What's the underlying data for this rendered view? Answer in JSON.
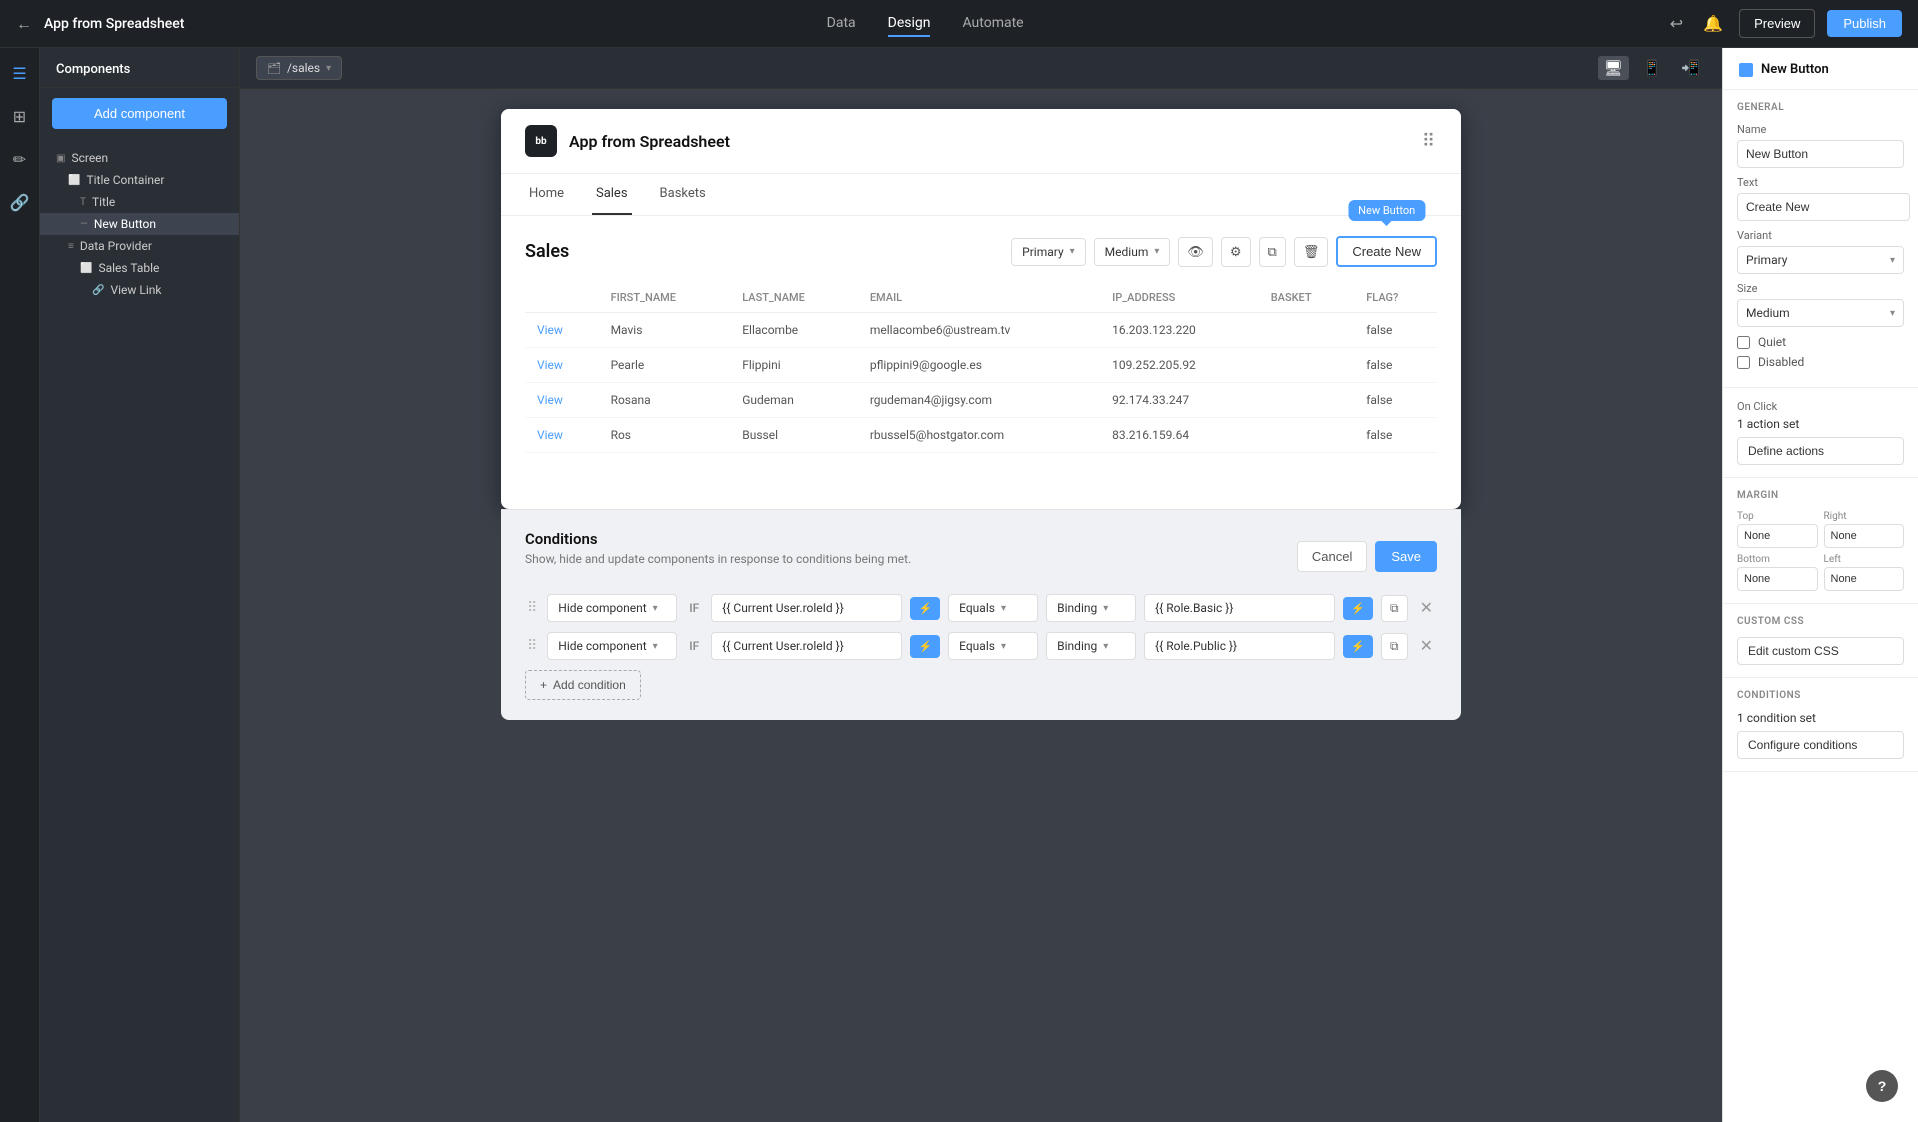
{
  "topbar": {
    "app_title": "App from Spreadsheet",
    "tabs": [
      "Data",
      "Design",
      "Automate"
    ],
    "active_tab": "Design",
    "preview_label": "Preview",
    "publish_label": "Publish"
  },
  "components_panel": {
    "header": "Components",
    "add_btn": "Add component",
    "tree": [
      {
        "id": "screen",
        "label": "Screen",
        "indent": 0,
        "icon": "▣",
        "active": false
      },
      {
        "id": "title-container",
        "label": "Title Container",
        "indent": 1,
        "icon": "⬜",
        "active": false
      },
      {
        "id": "title",
        "label": "Title",
        "indent": 2,
        "icon": "T",
        "active": false
      },
      {
        "id": "new-button",
        "label": "New Button",
        "indent": 2,
        "icon": "—",
        "active": true
      },
      {
        "id": "data-provider",
        "label": "Data Provider",
        "indent": 1,
        "icon": "≡",
        "active": false
      },
      {
        "id": "sales-table",
        "label": "Sales Table",
        "indent": 2,
        "icon": "⬜",
        "active": false
      },
      {
        "id": "view-link",
        "label": "View Link",
        "indent": 3,
        "icon": "🔗",
        "active": false
      }
    ]
  },
  "canvas": {
    "path": "/sales",
    "app_logo": "bb",
    "app_name": "App from Spreadsheet",
    "nav_items": [
      "Home",
      "Sales",
      "Baskets"
    ],
    "active_nav": "Sales",
    "section_title": "Sales",
    "toolbar": {
      "variant": "Primary",
      "size": "Medium"
    },
    "tooltip_label": "New Button",
    "create_new_label": "Create New",
    "table": {
      "columns": [
        "",
        "FIRST_NAME",
        "LAST_NAME",
        "EMAIL",
        "IP_ADDRESS",
        "BASKET",
        "FLAG?"
      ],
      "rows": [
        [
          "View",
          "Mavis",
          "Ellacombe",
          "mellacombe6@ustream.tv",
          "16.203.123.220",
          "",
          "false"
        ],
        [
          "View",
          "Pearle",
          "Flippini",
          "pflippini9@google.es",
          "109.252.205.92",
          "",
          "false"
        ],
        [
          "View",
          "Rosana",
          "Gudeman",
          "rgudeman4@jigsy.com",
          "92.174.33.247",
          "",
          "false"
        ],
        [
          "View",
          "Ros",
          "Bussel",
          "rbussel5@hostgator.com",
          "83.216.159.64",
          "",
          "false"
        ]
      ]
    }
  },
  "conditions": {
    "title": "Conditions",
    "description": "Show, hide and update components in response to conditions being met.",
    "cancel_label": "Cancel",
    "save_label": "Save",
    "rows": [
      {
        "action": "Hide component",
        "if_value": "{{ Current User.roleId }}",
        "operator": "Equals",
        "binding": "Binding",
        "value": "{{ Role.Basic }}"
      },
      {
        "action": "Hide component",
        "if_value": "{{ Current User.roleId }}",
        "operator": "Equals",
        "binding": "Binding",
        "value": "{{ Role.Public }}"
      }
    ],
    "add_condition_label": "Add condition"
  },
  "props": {
    "title": "New Button",
    "sections": {
      "general": "GENERAL",
      "on_click": "On Click",
      "margin": "MARGIN",
      "custom_css": "CUSTOM CSS",
      "conditions_section": "CONDITIONS"
    },
    "name_label": "Name",
    "name_value": "New Button",
    "text_label": "Text",
    "text_value": "Create New",
    "variant_label": "Variant",
    "variant_value": "Primary",
    "size_label": "Size",
    "size_value": "Medium",
    "quiet_label": "Quiet",
    "disabled_label": "Disabled",
    "action_set": "1 action set",
    "define_actions_label": "Define actions",
    "top_label": "Top",
    "top_value": "None",
    "right_label": "Right",
    "right_value": "None",
    "bottom_label": "Bottom",
    "bottom_value": "None",
    "left_label": "Left",
    "left_value": "None",
    "custom_css_label": "CUSTOM CSS",
    "edit_css_label": "Edit custom CSS",
    "conditions_count": "1 condition set",
    "configure_conditions_label": "Configure conditions"
  }
}
